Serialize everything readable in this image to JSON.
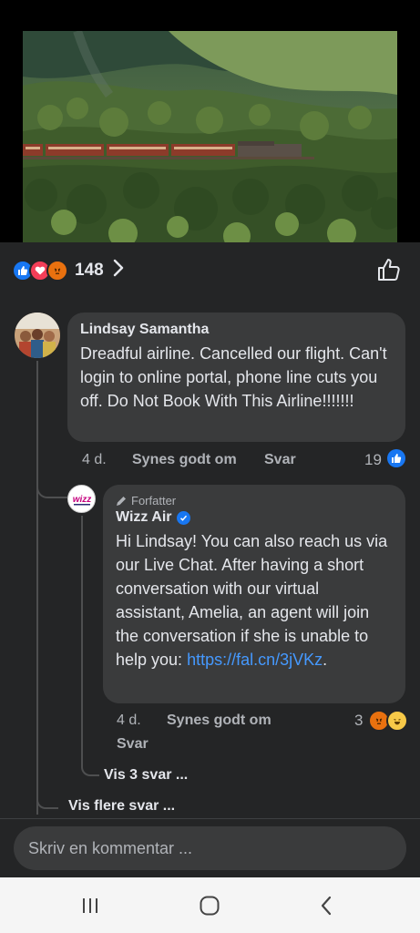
{
  "post": {
    "reactions_count": "148"
  },
  "comment_1": {
    "author": "Lindsay Samantha",
    "text": "Dreadful airline. Cancelled our flight. Can't login to online portal, phone line cuts you off. Do Not Book With This Airline!!!!!!!",
    "time": "4 d.",
    "like_label": "Synes godt om",
    "reply_label": "Svar",
    "likes": "19"
  },
  "reply_1": {
    "badge": "Forfatter",
    "author": "Wizz Air",
    "text": "Hi Lindsay! You can also reach us via our Live Chat. After having a short conversation with our virtual assistant, Amelia, an agent will join the conversation if she is unable to help you: ",
    "link": "https://fal.cn/3jVKz",
    "text_end": ".",
    "time": "4 d.",
    "like_label": "Synes godt om",
    "reply_label": "Svar",
    "reactions": "3"
  },
  "thread": {
    "view_replies": "Vis 3 svar ...",
    "view_more": "Vis flere svar ..."
  },
  "composer": {
    "placeholder": "Skriv en kommentar ..."
  },
  "colors": {
    "background": "#242526",
    "bubble": "#3a3b3c",
    "like_blue": "#1877f2",
    "link": "#4599ff"
  }
}
